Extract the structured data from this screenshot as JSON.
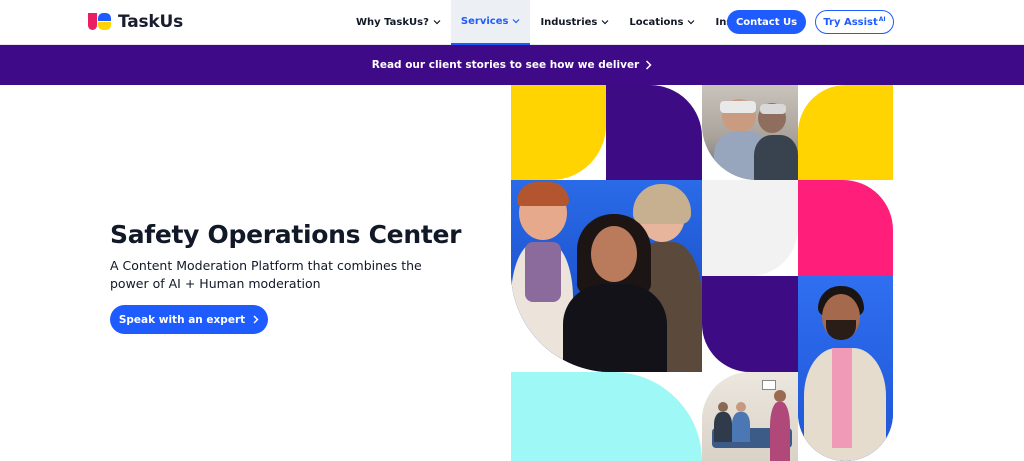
{
  "header": {
    "logo_text": "TaskUs",
    "nav": [
      {
        "label": "Why TaskUs?",
        "has_dropdown": true,
        "active": false
      },
      {
        "label": "Services",
        "has_dropdown": true,
        "active": true
      },
      {
        "label": "Industries",
        "has_dropdown": true,
        "active": false
      },
      {
        "label": "Locations",
        "has_dropdown": true,
        "active": false
      },
      {
        "label": "Insights",
        "has_dropdown": false,
        "active": false
      }
    ],
    "contact_label": "Contact Us",
    "assist_label": "Try Assist",
    "assist_sup": "AI"
  },
  "banner": {
    "text": "Read our client stories to see how we deliver",
    "icon": "chevron-right-icon"
  },
  "hero": {
    "title": "Safety Operations Center",
    "subtitle": "A Content Moderation Platform that combines the power of AI + Human moderation",
    "cta_label": "Speak with an expert",
    "cta_icon": "chevron-right-icon"
  },
  "colors": {
    "brand_blue": "#1f5cff",
    "brand_purple": "#3e0a87",
    "mosaic_yellow": "#ffd400",
    "mosaic_magenta": "#ff1f7a",
    "mosaic_cyan": "#9ef9f6",
    "mosaic_deep_purple": "#3d0c84"
  }
}
